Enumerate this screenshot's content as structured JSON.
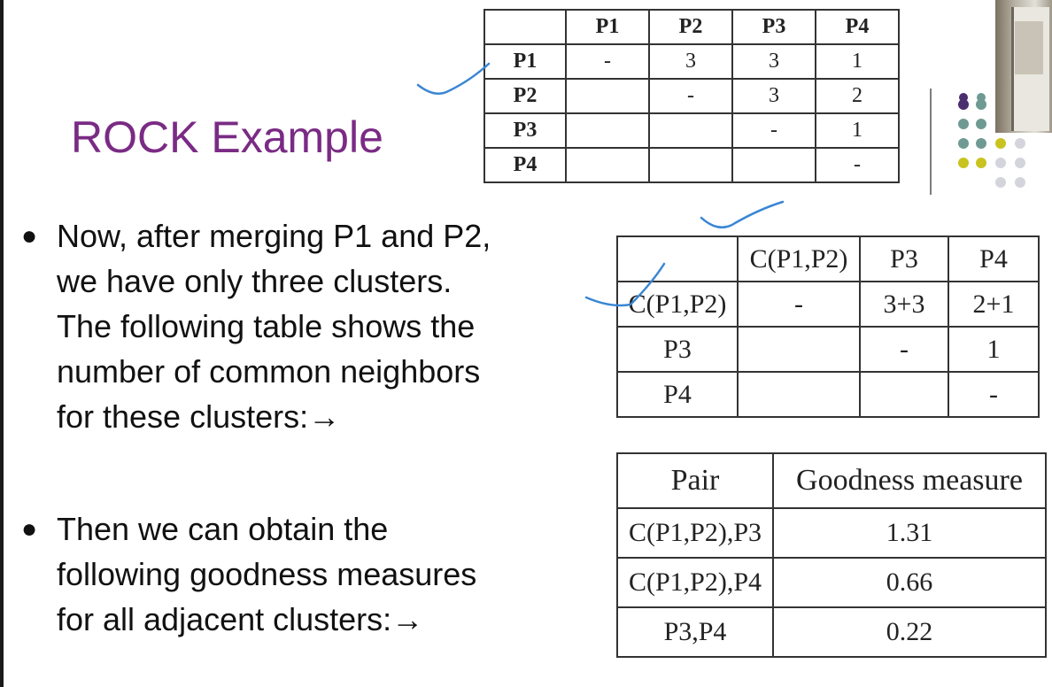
{
  "slide": {
    "title": "ROCK Example"
  },
  "bullets": [
    {
      "lines": [
        "Now, after merging P1 and P2,",
        "we have only three clusters.",
        "The following table shows the",
        "number of common neighbors",
        "for these clusters:→"
      ]
    },
    {
      "lines": [
        "Then we can obtain the",
        "following goodness measures",
        "for all adjacent clusters:→"
      ]
    }
  ],
  "neighbors_table": {
    "headers": [
      "P1",
      "P2",
      "P3",
      "P4"
    ],
    "rows": [
      {
        "label": "P1",
        "cells": [
          "-",
          "3",
          "3",
          "1"
        ]
      },
      {
        "label": "P2",
        "cells": [
          "",
          "-",
          "3",
          "2"
        ]
      },
      {
        "label": "P3",
        "cells": [
          "",
          "",
          "-",
          "1"
        ]
      },
      {
        "label": "P4",
        "cells": [
          "",
          "",
          "",
          "-"
        ]
      }
    ]
  },
  "merged_table": {
    "headers": [
      "C(P1,P2)",
      "P3",
      "P4"
    ],
    "rows": [
      {
        "label": "C(P1,P2)",
        "cells": [
          "-",
          "3+3",
          "2+1"
        ]
      },
      {
        "label": "P3",
        "cells": [
          "",
          "-",
          "1"
        ]
      },
      {
        "label": "P4",
        "cells": [
          "",
          "",
          "-"
        ]
      }
    ]
  },
  "goodness_table": {
    "headers": [
      "Pair",
      "Goodness measure"
    ],
    "rows": [
      {
        "pair": "C(P1,P2),P3",
        "value": "1.31"
      },
      {
        "pair": "C(P1,P2),P4",
        "value": "0.66"
      },
      {
        "pair": "P3,P4",
        "value": "0.22"
      }
    ]
  },
  "colors": {
    "title": "#7a2b84",
    "annotation_ink": "#3a86d4",
    "dot_purple": "#4b2e6e",
    "dot_teal": "#6f9a94",
    "dot_yellow": "#c9c320",
    "dot_gray": "#d4d4dc"
  }
}
